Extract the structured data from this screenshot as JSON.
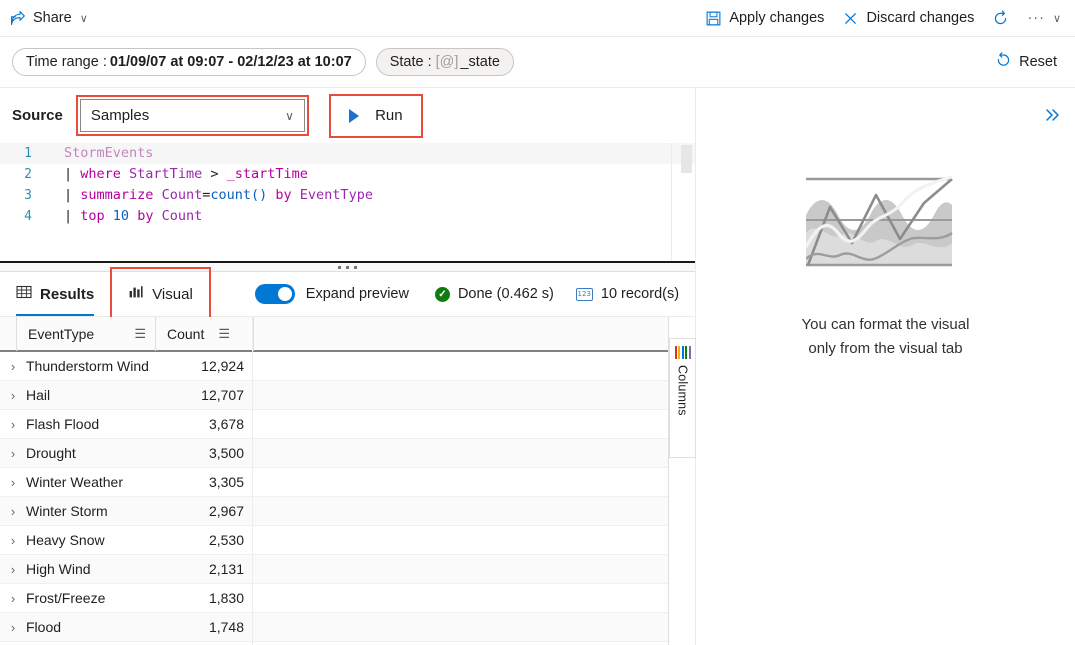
{
  "commandbar": {
    "share": {
      "label": "Share",
      "icon": "share-icon",
      "chevron": "∨"
    },
    "apply": {
      "label": "Apply changes",
      "icon": "save-icon"
    },
    "discard": {
      "label": "Discard changes",
      "icon": "close-icon"
    },
    "refresh": {
      "icon": "refresh-icon"
    },
    "overflow": {
      "label": "···",
      "chevron": "∨"
    }
  },
  "filterbar": {
    "time_range": {
      "label": "Time range :",
      "value": "01/09/07 at 09:07 - 02/12/23 at 10:07"
    },
    "state": {
      "label": "State :",
      "token": "[@]",
      "value": "_state"
    },
    "reset": {
      "label": "Reset",
      "icon": "undo-icon"
    }
  },
  "source": {
    "label": "Source",
    "selected": "Samples",
    "chevron": "∨",
    "run": {
      "label": "Run",
      "icon": "play-icon"
    }
  },
  "editor": {
    "lines": [
      {
        "num": "1",
        "tokens": [
          {
            "t": "StormEvents",
            "c": "kw-tbl"
          }
        ]
      },
      {
        "num": "2",
        "tokens": [
          {
            "t": "| ",
            "c": "kw-pipe"
          },
          {
            "t": "where",
            "c": "kw-op"
          },
          {
            "t": " ",
            "c": "kw-plain"
          },
          {
            "t": "StartTime",
            "c": "kw-col"
          },
          {
            "t": " ",
            "c": "kw-plain"
          },
          {
            "t": ">",
            "c": "kw-sym"
          },
          {
            "t": " ",
            "c": "kw-plain"
          },
          {
            "t": "_startTime",
            "c": "kw-var"
          }
        ]
      },
      {
        "num": "3",
        "tokens": [
          {
            "t": "| ",
            "c": "kw-pipe"
          },
          {
            "t": "summarize",
            "c": "kw-op"
          },
          {
            "t": " ",
            "c": "kw-plain"
          },
          {
            "t": "Count",
            "c": "kw-col"
          },
          {
            "t": "=",
            "c": "kw-sym"
          },
          {
            "t": "count()",
            "c": "kw-fn"
          },
          {
            "t": " ",
            "c": "kw-plain"
          },
          {
            "t": "by",
            "c": "kw-op"
          },
          {
            "t": " ",
            "c": "kw-plain"
          },
          {
            "t": "EventType",
            "c": "kw-col"
          }
        ]
      },
      {
        "num": "4",
        "tokens": [
          {
            "t": "| ",
            "c": "kw-pipe"
          },
          {
            "t": "top",
            "c": "kw-op"
          },
          {
            "t": " ",
            "c": "kw-plain"
          },
          {
            "t": "10",
            "c": "kw-num"
          },
          {
            "t": " ",
            "c": "kw-plain"
          },
          {
            "t": "by",
            "c": "kw-op"
          },
          {
            "t": " ",
            "c": "kw-plain"
          },
          {
            "t": "Count",
            "c": "kw-col"
          }
        ]
      }
    ]
  },
  "results": {
    "tabs": [
      {
        "label": "Results",
        "icon": "table-icon",
        "selected": true
      },
      {
        "label": "Visual",
        "icon": "chart-icon",
        "selected": false,
        "highlighted": true
      }
    ],
    "expand_preview": {
      "label": "Expand preview",
      "on": true
    },
    "status": {
      "label": "Done (0.462 s)",
      "icon": "check-icon"
    },
    "record_count": {
      "label": "10 record(s)",
      "icon": "number-icon"
    },
    "columns_rail": {
      "label": "Columns",
      "icon": "columns-icon"
    },
    "columns": [
      "EventType",
      "Count"
    ],
    "rows": [
      {
        "EventType": "Thunderstorm Wind",
        "Count": "12,924"
      },
      {
        "EventType": "Hail",
        "Count": "12,707"
      },
      {
        "EventType": "Flash Flood",
        "Count": "3,678"
      },
      {
        "EventType": "Drought",
        "Count": "3,500"
      },
      {
        "EventType": "Winter Weather",
        "Count": "3,305"
      },
      {
        "EventType": "Winter Storm",
        "Count": "2,967"
      },
      {
        "EventType": "Heavy Snow",
        "Count": "2,530"
      },
      {
        "EventType": "High Wind",
        "Count": "2,131"
      },
      {
        "EventType": "Frost/Freeze",
        "Count": "1,830"
      },
      {
        "EventType": "Flood",
        "Count": "1,748"
      }
    ],
    "row_expander": "›"
  },
  "visual_pane": {
    "expand_icon": "double-chevron-right-icon",
    "placeholder_art": "chart-placeholder-illustration",
    "message_line1": "You can format the visual",
    "message_line2": "only from the visual tab"
  },
  "colors": {
    "accent": "#0078d4",
    "highlight_box": "#e74c3c",
    "success": "#107c10",
    "text": "#201f1e"
  }
}
